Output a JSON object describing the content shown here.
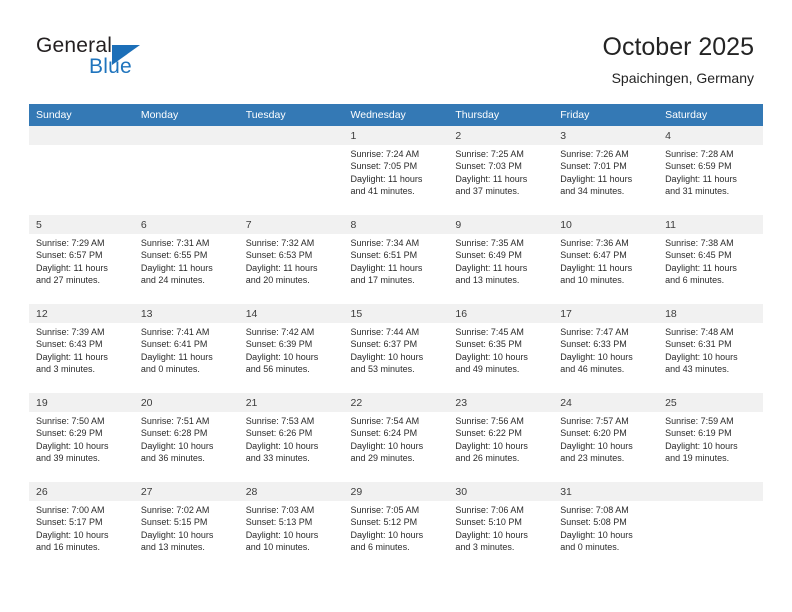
{
  "brand": {
    "word_one": "General",
    "word_two": "Blue",
    "triangle_color": "#1c6fb8",
    "blue_text_color": "#1f74bd"
  },
  "header": {
    "title": "October 2025",
    "subtitle": "Spaichingen, Germany"
  },
  "theme": {
    "header_blue": "#3479b5",
    "daynum_band": "#f1f1f1",
    "text": "#2b2b2b"
  },
  "weekday_headers": [
    "Sunday",
    "Monday",
    "Tuesday",
    "Wednesday",
    "Thursday",
    "Friday",
    "Saturday"
  ],
  "weeks": [
    [
      {
        "day": "",
        "sunrise": "",
        "sunset": "",
        "daylight_line1": "",
        "daylight_line2": ""
      },
      {
        "day": "",
        "sunrise": "",
        "sunset": "",
        "daylight_line1": "",
        "daylight_line2": ""
      },
      {
        "day": "",
        "sunrise": "",
        "sunset": "",
        "daylight_line1": "",
        "daylight_line2": ""
      },
      {
        "day": "1",
        "sunrise": "Sunrise: 7:24 AM",
        "sunset": "Sunset: 7:05 PM",
        "daylight_line1": "Daylight: 11 hours",
        "daylight_line2": "and 41 minutes."
      },
      {
        "day": "2",
        "sunrise": "Sunrise: 7:25 AM",
        "sunset": "Sunset: 7:03 PM",
        "daylight_line1": "Daylight: 11 hours",
        "daylight_line2": "and 37 minutes."
      },
      {
        "day": "3",
        "sunrise": "Sunrise: 7:26 AM",
        "sunset": "Sunset: 7:01 PM",
        "daylight_line1": "Daylight: 11 hours",
        "daylight_line2": "and 34 minutes."
      },
      {
        "day": "4",
        "sunrise": "Sunrise: 7:28 AM",
        "sunset": "Sunset: 6:59 PM",
        "daylight_line1": "Daylight: 11 hours",
        "daylight_line2": "and 31 minutes."
      }
    ],
    [
      {
        "day": "5",
        "sunrise": "Sunrise: 7:29 AM",
        "sunset": "Sunset: 6:57 PM",
        "daylight_line1": "Daylight: 11 hours",
        "daylight_line2": "and 27 minutes."
      },
      {
        "day": "6",
        "sunrise": "Sunrise: 7:31 AM",
        "sunset": "Sunset: 6:55 PM",
        "daylight_line1": "Daylight: 11 hours",
        "daylight_line2": "and 24 minutes."
      },
      {
        "day": "7",
        "sunrise": "Sunrise: 7:32 AM",
        "sunset": "Sunset: 6:53 PM",
        "daylight_line1": "Daylight: 11 hours",
        "daylight_line2": "and 20 minutes."
      },
      {
        "day": "8",
        "sunrise": "Sunrise: 7:34 AM",
        "sunset": "Sunset: 6:51 PM",
        "daylight_line1": "Daylight: 11 hours",
        "daylight_line2": "and 17 minutes."
      },
      {
        "day": "9",
        "sunrise": "Sunrise: 7:35 AM",
        "sunset": "Sunset: 6:49 PM",
        "daylight_line1": "Daylight: 11 hours",
        "daylight_line2": "and 13 minutes."
      },
      {
        "day": "10",
        "sunrise": "Sunrise: 7:36 AM",
        "sunset": "Sunset: 6:47 PM",
        "daylight_line1": "Daylight: 11 hours",
        "daylight_line2": "and 10 minutes."
      },
      {
        "day": "11",
        "sunrise": "Sunrise: 7:38 AM",
        "sunset": "Sunset: 6:45 PM",
        "daylight_line1": "Daylight: 11 hours",
        "daylight_line2": "and 6 minutes."
      }
    ],
    [
      {
        "day": "12",
        "sunrise": "Sunrise: 7:39 AM",
        "sunset": "Sunset: 6:43 PM",
        "daylight_line1": "Daylight: 11 hours",
        "daylight_line2": "and 3 minutes."
      },
      {
        "day": "13",
        "sunrise": "Sunrise: 7:41 AM",
        "sunset": "Sunset: 6:41 PM",
        "daylight_line1": "Daylight: 11 hours",
        "daylight_line2": "and 0 minutes."
      },
      {
        "day": "14",
        "sunrise": "Sunrise: 7:42 AM",
        "sunset": "Sunset: 6:39 PM",
        "daylight_line1": "Daylight: 10 hours",
        "daylight_line2": "and 56 minutes."
      },
      {
        "day": "15",
        "sunrise": "Sunrise: 7:44 AM",
        "sunset": "Sunset: 6:37 PM",
        "daylight_line1": "Daylight: 10 hours",
        "daylight_line2": "and 53 minutes."
      },
      {
        "day": "16",
        "sunrise": "Sunrise: 7:45 AM",
        "sunset": "Sunset: 6:35 PM",
        "daylight_line1": "Daylight: 10 hours",
        "daylight_line2": "and 49 minutes."
      },
      {
        "day": "17",
        "sunrise": "Sunrise: 7:47 AM",
        "sunset": "Sunset: 6:33 PM",
        "daylight_line1": "Daylight: 10 hours",
        "daylight_line2": "and 46 minutes."
      },
      {
        "day": "18",
        "sunrise": "Sunrise: 7:48 AM",
        "sunset": "Sunset: 6:31 PM",
        "daylight_line1": "Daylight: 10 hours",
        "daylight_line2": "and 43 minutes."
      }
    ],
    [
      {
        "day": "19",
        "sunrise": "Sunrise: 7:50 AM",
        "sunset": "Sunset: 6:29 PM",
        "daylight_line1": "Daylight: 10 hours",
        "daylight_line2": "and 39 minutes."
      },
      {
        "day": "20",
        "sunrise": "Sunrise: 7:51 AM",
        "sunset": "Sunset: 6:28 PM",
        "daylight_line1": "Daylight: 10 hours",
        "daylight_line2": "and 36 minutes."
      },
      {
        "day": "21",
        "sunrise": "Sunrise: 7:53 AM",
        "sunset": "Sunset: 6:26 PM",
        "daylight_line1": "Daylight: 10 hours",
        "daylight_line2": "and 33 minutes."
      },
      {
        "day": "22",
        "sunrise": "Sunrise: 7:54 AM",
        "sunset": "Sunset: 6:24 PM",
        "daylight_line1": "Daylight: 10 hours",
        "daylight_line2": "and 29 minutes."
      },
      {
        "day": "23",
        "sunrise": "Sunrise: 7:56 AM",
        "sunset": "Sunset: 6:22 PM",
        "daylight_line1": "Daylight: 10 hours",
        "daylight_line2": "and 26 minutes."
      },
      {
        "day": "24",
        "sunrise": "Sunrise: 7:57 AM",
        "sunset": "Sunset: 6:20 PM",
        "daylight_line1": "Daylight: 10 hours",
        "daylight_line2": "and 23 minutes."
      },
      {
        "day": "25",
        "sunrise": "Sunrise: 7:59 AM",
        "sunset": "Sunset: 6:19 PM",
        "daylight_line1": "Daylight: 10 hours",
        "daylight_line2": "and 19 minutes."
      }
    ],
    [
      {
        "day": "26",
        "sunrise": "Sunrise: 7:00 AM",
        "sunset": "Sunset: 5:17 PM",
        "daylight_line1": "Daylight: 10 hours",
        "daylight_line2": "and 16 minutes."
      },
      {
        "day": "27",
        "sunrise": "Sunrise: 7:02 AM",
        "sunset": "Sunset: 5:15 PM",
        "daylight_line1": "Daylight: 10 hours",
        "daylight_line2": "and 13 minutes."
      },
      {
        "day": "28",
        "sunrise": "Sunrise: 7:03 AM",
        "sunset": "Sunset: 5:13 PM",
        "daylight_line1": "Daylight: 10 hours",
        "daylight_line2": "and 10 minutes."
      },
      {
        "day": "29",
        "sunrise": "Sunrise: 7:05 AM",
        "sunset": "Sunset: 5:12 PM",
        "daylight_line1": "Daylight: 10 hours",
        "daylight_line2": "and 6 minutes."
      },
      {
        "day": "30",
        "sunrise": "Sunrise: 7:06 AM",
        "sunset": "Sunset: 5:10 PM",
        "daylight_line1": "Daylight: 10 hours",
        "daylight_line2": "and 3 minutes."
      },
      {
        "day": "31",
        "sunrise": "Sunrise: 7:08 AM",
        "sunset": "Sunset: 5:08 PM",
        "daylight_line1": "Daylight: 10 hours",
        "daylight_line2": "and 0 minutes."
      },
      {
        "day": "",
        "sunrise": "",
        "sunset": "",
        "daylight_line1": "",
        "daylight_line2": ""
      }
    ]
  ]
}
